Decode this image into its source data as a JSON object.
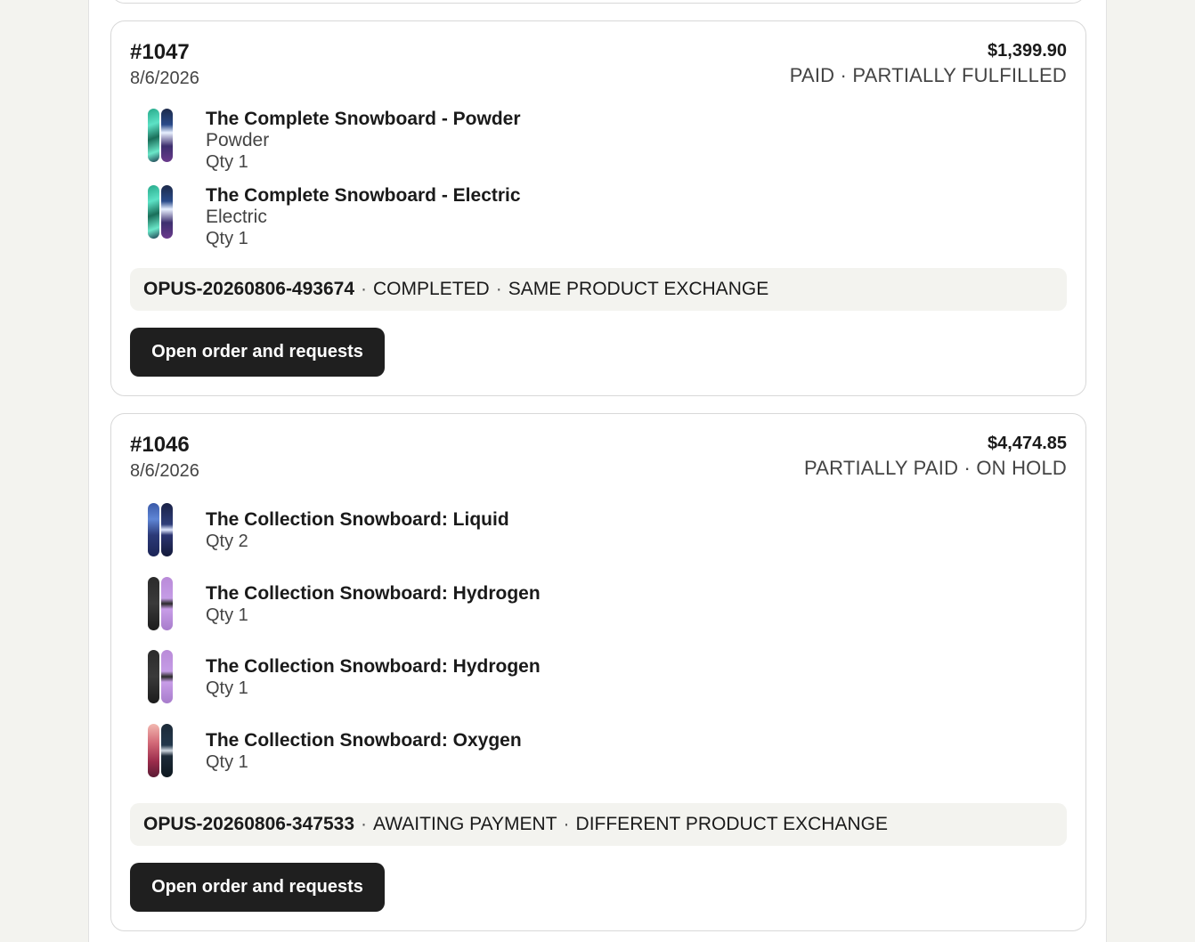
{
  "orders": [
    {
      "number": "#1047",
      "date": "8/6/2026",
      "total": "$1,399.90",
      "status": "PAID · PARTIALLY FULFILLED",
      "items": [
        {
          "title": "The Complete Snowboard - Powder",
          "variant": "Powder",
          "qty": "Qty 1",
          "image": "snowboard-powder"
        },
        {
          "title": "The Complete Snowboard - Electric",
          "variant": "Electric",
          "qty": "Qty 1",
          "image": "snowboard-electric"
        }
      ],
      "request": {
        "id": "OPUS-20260806-493674",
        "state": "COMPLETED",
        "type": "SAME PRODUCT EXCHANGE"
      },
      "button_label": "Open order and requests"
    },
    {
      "number": "#1046",
      "date": "8/6/2026",
      "total": "$4,474.85",
      "status": "PARTIALLY PAID · ON HOLD",
      "items": [
        {
          "title": "The Collection Snowboard: Liquid",
          "qty": "Qty 2",
          "image": "snowboard-liquid"
        },
        {
          "title": "The Collection Snowboard: Hydrogen",
          "qty": "Qty 1",
          "image": "snowboard-hydrogen"
        },
        {
          "title": "The Collection Snowboard: Hydrogen",
          "qty": "Qty 1",
          "image": "snowboard-hydrogen"
        },
        {
          "title": "The Collection Snowboard: Oxygen",
          "qty": "Qty 1",
          "image": "snowboard-oxygen"
        }
      ],
      "request": {
        "id": "OPUS-20260806-347533",
        "state": "AWAITING PAYMENT",
        "type": "DIFFERENT PRODUCT EXCHANGE"
      },
      "button_label": "Open order and requests"
    }
  ],
  "separator": "·",
  "colors": {
    "page_bg": "#f3f3ef",
    "card_border": "#d8d8d8",
    "button_bg": "#1f1f1f",
    "request_bg": "#f3f3ef"
  }
}
